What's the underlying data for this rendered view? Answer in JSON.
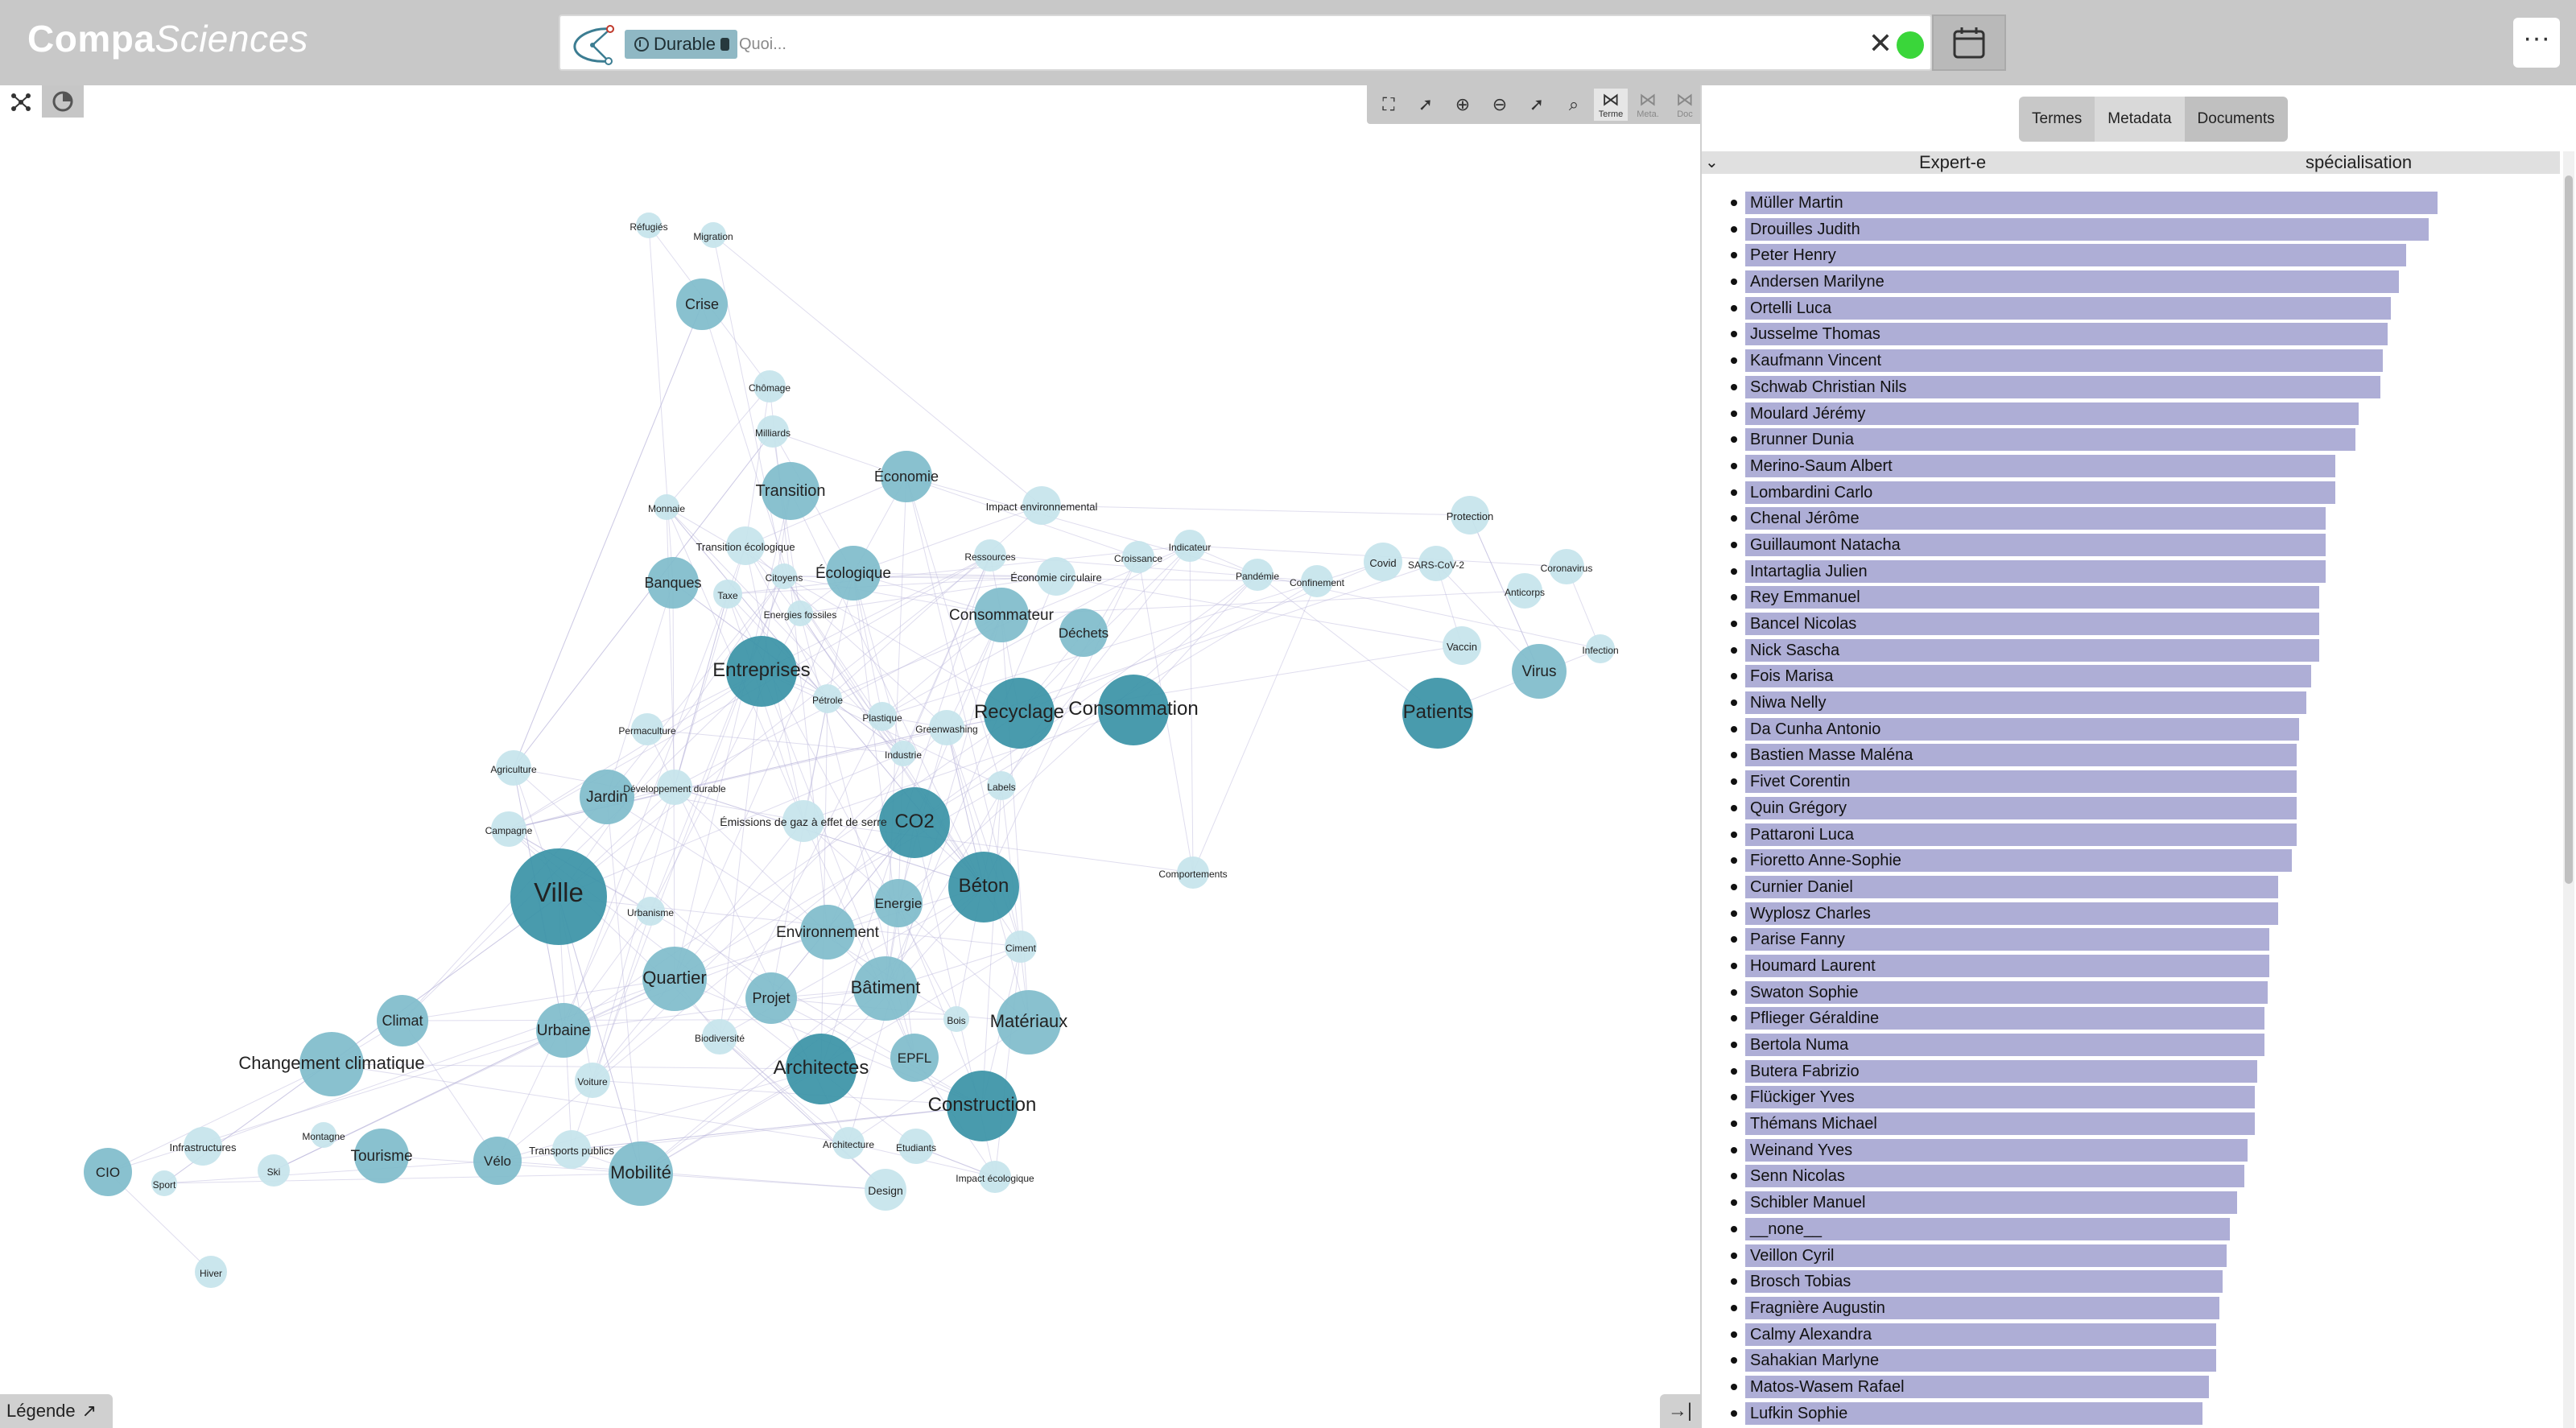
{
  "app": {
    "logo_part1": "Compa",
    "logo_part2": "Sciences"
  },
  "search": {
    "chip_label": "Durable",
    "placeholder": "Quoi...",
    "clear_label": "✕",
    "status_color": "#3ad63a"
  },
  "header": {
    "more_label": "···"
  },
  "graph_toolbar": {
    "items": [
      {
        "icon": "fit-screen-icon",
        "label": ""
      },
      {
        "icon": "select-cursor-icon",
        "label": ""
      },
      {
        "icon": "zoom-in-cursor-icon",
        "label": ""
      },
      {
        "icon": "zoom-out-cursor-icon",
        "label": ""
      },
      {
        "icon": "pointer-cursor-icon",
        "label": ""
      },
      {
        "icon": "magnify-cursor-icon",
        "label": ""
      },
      {
        "icon": "network-icon",
        "label": "Terme"
      },
      {
        "icon": "network-icon",
        "label": "Meta."
      },
      {
        "icon": "network-icon",
        "label": "Doc"
      }
    ]
  },
  "legend": {
    "label": "Légende",
    "arrow": "↗"
  },
  "collapse_label": "→|",
  "panel": {
    "tabs": [
      "Termes",
      "Metadata",
      "Documents"
    ],
    "col1": "Expert-e",
    "col2": "spécialisation"
  },
  "experts": [
    {
      "name": "Müller Martin",
      "score": 1.0
    },
    {
      "name": "Drouilles Judith",
      "score": 0.987
    },
    {
      "name": "Peter Henry",
      "score": 0.955
    },
    {
      "name": "Andersen Marilyne",
      "score": 0.944
    },
    {
      "name": "Ortelli Luca",
      "score": 0.932
    },
    {
      "name": "Jusselme Thomas",
      "score": 0.928
    },
    {
      "name": "Kaufmann Vincent",
      "score": 0.921
    },
    {
      "name": "Schwab Christian Nils",
      "score": 0.917
    },
    {
      "name": "Moulard Jérémy",
      "score": 0.886
    },
    {
      "name": "Brunner Dunia",
      "score": 0.881
    },
    {
      "name": "Merino-Saum Albert",
      "score": 0.852
    },
    {
      "name": "Lombardini Carlo",
      "score": 0.852
    },
    {
      "name": "Chenal Jérôme",
      "score": 0.838
    },
    {
      "name": "Guillaumont Natacha",
      "score": 0.838
    },
    {
      "name": "Intartaglia Julien",
      "score": 0.838
    },
    {
      "name": "Rey Emmanuel",
      "score": 0.829
    },
    {
      "name": "Bancel Nicolas",
      "score": 0.829
    },
    {
      "name": "Nick Sascha",
      "score": 0.829
    },
    {
      "name": "Fois Marisa",
      "score": 0.817
    },
    {
      "name": "Niwa Nelly",
      "score": 0.81
    },
    {
      "name": "Da Cunha Antonio",
      "score": 0.8
    },
    {
      "name": "Bastien Masse Maléna",
      "score": 0.797
    },
    {
      "name": "Fivet Corentin",
      "score": 0.797
    },
    {
      "name": "Quin Grégory",
      "score": 0.797
    },
    {
      "name": "Pattaroni Luca",
      "score": 0.797
    },
    {
      "name": "Fioretto Anne-Sophie",
      "score": 0.79
    },
    {
      "name": "Curnier Daniel",
      "score": 0.77
    },
    {
      "name": "Wyplosz Charles",
      "score": 0.77
    },
    {
      "name": "Parise Fanny",
      "score": 0.757
    },
    {
      "name": "Houmard Laurent",
      "score": 0.757
    },
    {
      "name": "Swaton Sophie",
      "score": 0.755
    },
    {
      "name": "Pflieger Géraldine",
      "score": 0.75
    },
    {
      "name": "Bertola Numa",
      "score": 0.75
    },
    {
      "name": "Butera Fabrizio",
      "score": 0.74
    },
    {
      "name": "Flückiger Yves",
      "score": 0.736
    },
    {
      "name": "Thémans Michael",
      "score": 0.736
    },
    {
      "name": "Weinand Yves",
      "score": 0.726
    },
    {
      "name": "Senn Nicolas",
      "score": 0.721
    },
    {
      "name": "Schibler Manuel",
      "score": 0.71
    },
    {
      "name": "__none__",
      "score": 0.7
    },
    {
      "name": "Veillon Cyril",
      "score": 0.695
    },
    {
      "name": "Brosch Tobias",
      "score": 0.69
    },
    {
      "name": "Fragnière Augustin",
      "score": 0.685
    },
    {
      "name": "Calmy Alexandra",
      "score": 0.68
    },
    {
      "name": "Sahakian Marlyne",
      "score": 0.68
    },
    {
      "name": "Matos-Wasem Rafael",
      "score": 0.67
    },
    {
      "name": "Lufkin Sophie",
      "score": 0.66
    }
  ],
  "graph": {
    "colors": {
      "node_dark": "#3a93a6",
      "node_mid": "#7fbccb",
      "node_light": "#c6e4ec",
      "edge": "#b7b3d9"
    },
    "nodes": [
      {
        "label": "Ville",
        "weight": 60
      },
      {
        "label": "CO2",
        "weight": 44
      },
      {
        "label": "Entreprises",
        "weight": 44
      },
      {
        "label": "Consommation",
        "weight": 44
      },
      {
        "label": "Recyclage",
        "weight": 44
      },
      {
        "label": "Architectes",
        "weight": 44
      },
      {
        "label": "Béton",
        "weight": 44
      },
      {
        "label": "Construction",
        "weight": 44
      },
      {
        "label": "Patients",
        "weight": 44
      },
      {
        "label": "Matériaux",
        "weight": 40
      },
      {
        "label": "Changement climatique",
        "weight": 40
      },
      {
        "label": "Quartier",
        "weight": 40
      },
      {
        "label": "Bâtiment",
        "weight": 40
      },
      {
        "label": "Mobilité",
        "weight": 40
      },
      {
        "label": "Consommateur",
        "weight": 34
      },
      {
        "label": "Jardin",
        "weight": 34
      },
      {
        "label": "Environnement",
        "weight": 34
      },
      {
        "label": "Transition",
        "weight": 36
      },
      {
        "label": "Écologique",
        "weight": 34
      },
      {
        "label": "Virus",
        "weight": 34
      },
      {
        "label": "Urbaine",
        "weight": 34
      },
      {
        "label": "Tourisme",
        "weight": 34
      },
      {
        "label": "Crise",
        "weight": 32
      },
      {
        "label": "Économie",
        "weight": 32
      },
      {
        "label": "Banques",
        "weight": 32
      },
      {
        "label": "Projet",
        "weight": 32
      },
      {
        "label": "Climat",
        "weight": 32
      },
      {
        "label": "EPFL",
        "weight": 30
      },
      {
        "label": "Vélo",
        "weight": 30
      },
      {
        "label": "Déchets",
        "weight": 30
      },
      {
        "label": "Energie",
        "weight": 30
      },
      {
        "label": "CIO",
        "weight": 30
      },
      {
        "label": "Design",
        "weight": 26
      },
      {
        "label": "Émissions de gaz à effet de serre",
        "weight": 26
      },
      {
        "label": "Impact environnemental",
        "weight": 24
      },
      {
        "label": "Greenwashing",
        "weight": 22
      },
      {
        "label": "Transports publics",
        "weight": 24
      },
      {
        "label": "Économie circulaire",
        "weight": 24
      },
      {
        "label": "Transition écologique",
        "weight": 24
      },
      {
        "label": "Agriculture",
        "weight": 22
      },
      {
        "label": "Campagne",
        "weight": 22
      },
      {
        "label": "Vaccin",
        "weight": 24
      },
      {
        "label": "Protection",
        "weight": 24
      },
      {
        "label": "Covid",
        "weight": 24
      },
      {
        "label": "SARS-CoV-2",
        "weight": 22
      },
      {
        "label": "Anticorps",
        "weight": 22
      },
      {
        "label": "Coronavirus",
        "weight": 22
      },
      {
        "label": "Voiture",
        "weight": 22
      },
      {
        "label": "Biodiversité",
        "weight": 22
      },
      {
        "label": "Hiver",
        "weight": 20
      },
      {
        "label": "Ski",
        "weight": 20
      },
      {
        "label": "Infrastructures",
        "weight": 24
      },
      {
        "label": "Permaculture",
        "weight": 20
      },
      {
        "label": "Développement durable",
        "weight": 22
      },
      {
        "label": "Ciment",
        "weight": 20
      },
      {
        "label": "Architecture",
        "weight": 20
      },
      {
        "label": "Etudiants",
        "weight": 22
      },
      {
        "label": "Impact écologique",
        "weight": 20
      },
      {
        "label": "Chômage",
        "weight": 20
      },
      {
        "label": "Milliards",
        "weight": 20
      },
      {
        "label": "Indicateur",
        "weight": 20
      },
      {
        "label": "Ressources",
        "weight": 20
      },
      {
        "label": "Croissance",
        "weight": 20
      },
      {
        "label": "Pandémie",
        "weight": 20
      },
      {
        "label": "Confinement",
        "weight": 20
      },
      {
        "label": "Comportements",
        "weight": 20
      },
      {
        "label": "Pétrole",
        "weight": 18
      },
      {
        "label": "Plastique",
        "weight": 18
      },
      {
        "label": "Labels",
        "weight": 18
      },
      {
        "label": "Urbanisme",
        "weight": 18
      },
      {
        "label": "Taxe",
        "weight": 18
      },
      {
        "label": "Monnaie",
        "weight": 16
      },
      {
        "label": "Migration",
        "weight": 16
      },
      {
        "label": "Réfugiés",
        "weight": 16
      },
      {
        "label": "Infection",
        "weight": 18
      },
      {
        "label": "Energies fossiles",
        "weight": 16
      },
      {
        "label": "Industrie",
        "weight": 16
      },
      {
        "label": "Bois",
        "weight": 16
      },
      {
        "label": "Citoyens",
        "weight": 16
      },
      {
        "label": "Sport",
        "weight": 16
      },
      {
        "label": "Montagne",
        "weight": 16
      }
    ]
  }
}
